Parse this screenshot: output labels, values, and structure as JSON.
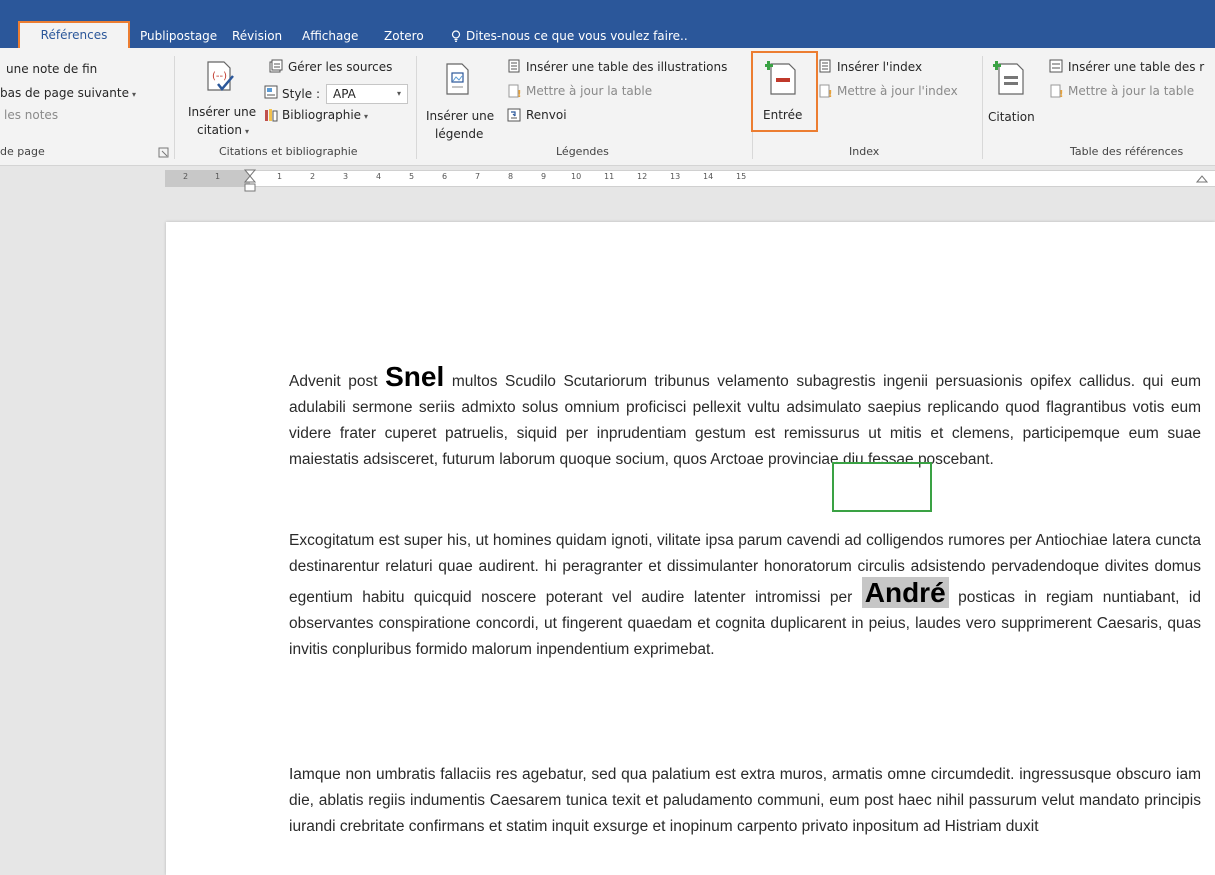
{
  "tabs": {
    "references": "Références",
    "mailings": "Publipostage",
    "review": "Révision",
    "view": "Affichage",
    "zotero": "Zotero",
    "tell_me": "Dites-nous ce que vous voulez faire.."
  },
  "ribbon": {
    "footnotes": {
      "insert_endnote": "une note de fin",
      "next_footnote": "bas de page suivante",
      "show_notes": "les notes",
      "group_label": "de page"
    },
    "citations": {
      "insert_citation_line1": "Insérer une",
      "insert_citation_line2": "citation",
      "manage_sources": "Gérer les sources",
      "style_label": "Style :",
      "style_value": "APA",
      "bibliography": "Bibliographie",
      "group_label": "Citations et bibliographie"
    },
    "captions": {
      "insert_caption_line1": "Insérer une",
      "insert_caption_line2": "légende",
      "insert_table_of_figures": "Insérer une table des illustrations",
      "update_table": "Mettre à jour la table",
      "cross_reference": "Renvoi",
      "group_label": "Légendes"
    },
    "index": {
      "mark_entry": "Entrée",
      "insert_index": "Insérer l'index",
      "update_index": "Mettre à jour l'index",
      "group_label": "Index"
    },
    "table_of_authorities": {
      "mark_citation": "Citation",
      "insert_table": "Insérer une table des r",
      "update_table": "Mettre à jour la table",
      "group_label": "Table des références"
    }
  },
  "ruler": {
    "left_numbers": [
      "2",
      "1"
    ],
    "right_numbers": [
      "1",
      "2",
      "3",
      "4",
      "5",
      "6",
      "7",
      "8",
      "9",
      "10",
      "11",
      "12",
      "13",
      "14",
      "15"
    ]
  },
  "document": {
    "p1_before": "Advenit post ",
    "p1_highlight": "Snel",
    "p1_after": " multos Scudilo Scutariorum tribunus velamento subagrestis ingenii persuasionis opifex callidus. qui eum adulabili sermone seriis admixto solus omnium proficisci pellexit vultu adsimulato saepius replicando quod flagrantibus votis eum videre frater cuperet patruelis, siquid per inprudentiam gestum est remissurus ut mitis et clemens, participemque eum suae maiestatis adsisceret, futurum laborum quoque socium, quos Arctoae provinciae diu fessae poscebant.",
    "p2_before": "Excogitatum est super his, ut homines quidam ignoti, vilitate ipsa parum cavendi ad colligendos rumores per Antiochiae latera cuncta destinarentur relaturi quae audirent. hi peragranter et dissimulanter honoratorum circulis adsistendo pervadendoque divites domus egentium habitu quicquid noscere poterant vel audire latenter intromissi per ",
    "p2_highlight": "André",
    "p2_after": " posticas in regiam nuntiabant, id observantes conspiratione concordi, ut fingerent quaedam et cognita duplicarent in peius, laudes vero supprimerent Caesaris, quas invitis conpluribus formido malorum inpendentium exprimebat.",
    "p3": "Iamque non umbratis fallaciis res agebatur, sed qua palatium est extra muros, armatis omne circumdedit. ingressusque obscuro iam die, ablatis regiis indumentis Caesarem tunica texit et paludamento communi, eum post haec nihil passurum velut mandato principis iurandi crebritate confirmans et statim inquit exsurge et inopinum carpento privato inpositum ad Histriam duxit"
  },
  "colors": {
    "ribbon_tab_bar": "#2b579a",
    "orange_highlight": "#ec7d31",
    "green_highlight": "#3aa244"
  }
}
